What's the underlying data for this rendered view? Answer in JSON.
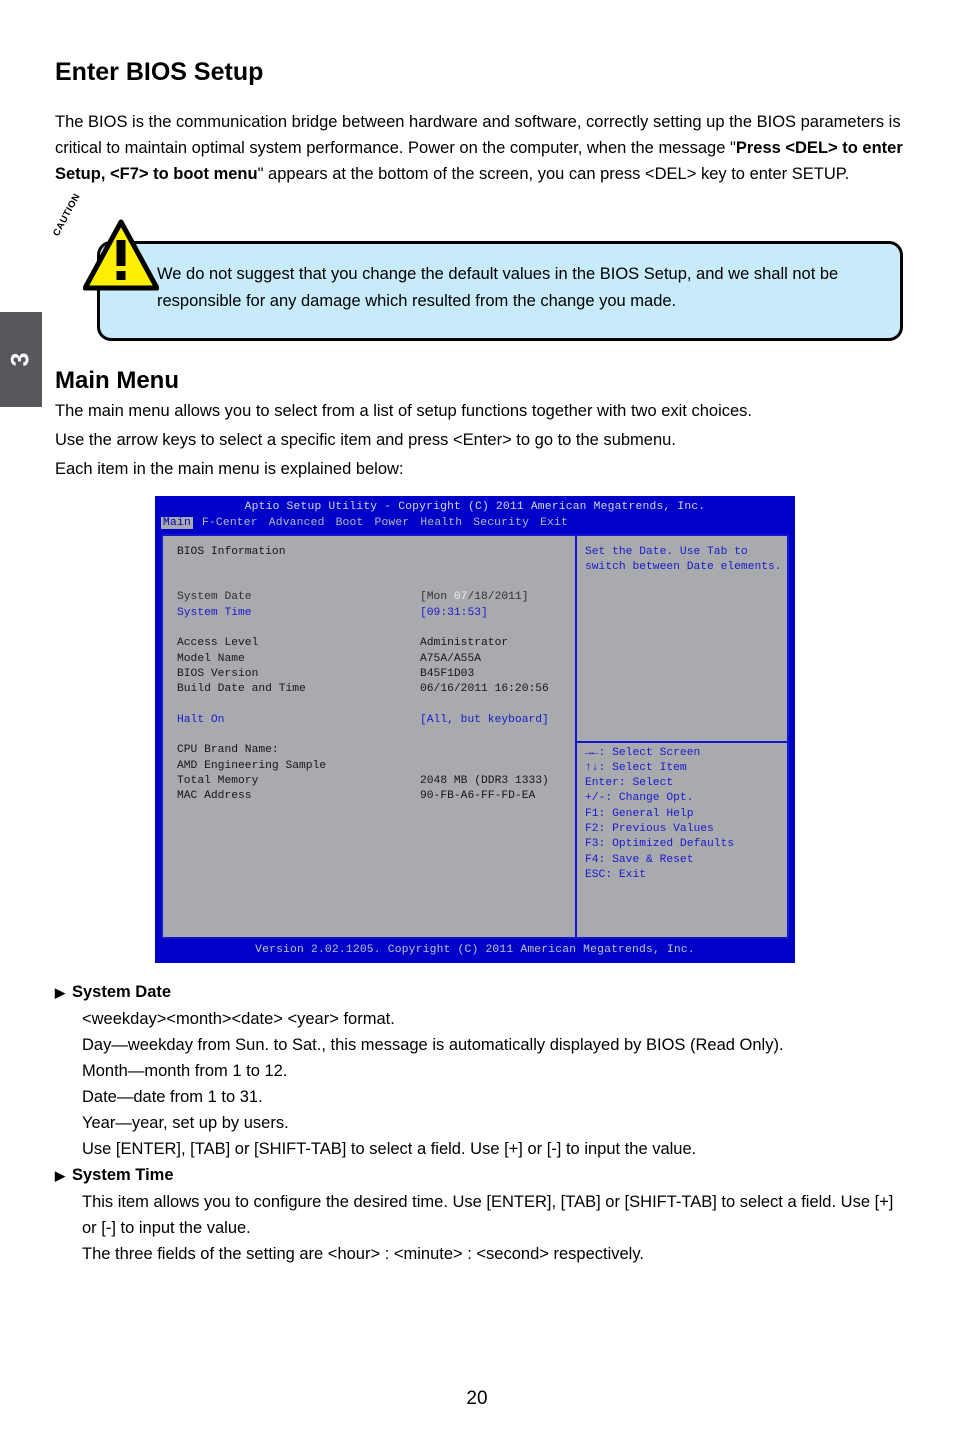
{
  "chapter_tab": {
    "number": "3"
  },
  "headings": {
    "enter_bios": "Enter BIOS Setup",
    "main_menu": "Main Menu"
  },
  "intro": {
    "part1": "The BIOS is the communication bridge between hardware and software, correctly setting up the BIOS parameters is critical to maintain optimal system performance. Power on the computer, when the message \"",
    "bold": "Press <DEL> to enter Setup, <F7> to boot menu",
    "part2": "\" appears at the bottom of the screen, you can press <DEL> key to enter SETUP."
  },
  "caution": {
    "label": "CAUTION",
    "mark": "!",
    "text": "We do not suggest that you change the default values in the BIOS Setup, and we shall not be responsible for any damage which resulted from the change you made."
  },
  "main_menu_desc": {
    "line1": "The main menu allows you to select from a list of setup functions together with two exit choices.",
    "line2": "Use the arrow keys to select a specific item and press <Enter> to go to the submenu.",
    "line3": "Each item in the main menu is explained below:"
  },
  "bios": {
    "titlebar": "Aptio Setup Utility - Copyright (C) 2011 American Megatrends, Inc.",
    "tabs": [
      {
        "label": "Main",
        "active": true
      },
      {
        "label": "F-Center",
        "active": false
      },
      {
        "label": "Advanced",
        "active": false
      },
      {
        "label": "Boot",
        "active": false
      },
      {
        "label": "Power",
        "active": false
      },
      {
        "label": "Health",
        "active": false
      },
      {
        "label": "Security",
        "active": false
      },
      {
        "label": "Exit",
        "active": false
      }
    ],
    "section_title": "BIOS Information",
    "rows": {
      "system_date_label": "System Date",
      "system_date_pre": "[Mon ",
      "system_date_hl": "07",
      "system_date_post": "/18/2011]",
      "system_time_label": "System Time",
      "system_time_value": "[09:31:53]",
      "access_level_label": "Access Level",
      "access_level_value": "Administrator",
      "model_name_label": "Model Name",
      "model_name_value": "A75A/A55A",
      "bios_version_label": "BIOS Version",
      "bios_version_value": "B45F1D03",
      "build_date_label": "Build Date and Time",
      "build_date_value": "06/16/2011 16:20:56",
      "halt_on_label": "Halt On",
      "halt_on_value": "[All, but keyboard]",
      "cpu_brand_label": "CPU Brand Name:",
      "cpu_brand_value": "AMD Engineering Sample",
      "total_memory_label": "Total Memory",
      "total_memory_value": "2048 MB (DDR3 1333)",
      "mac_address_label": "MAC Address",
      "mac_address_value": "90-FB-A6-FF-FD-EA"
    },
    "help_text": "Set the Date. Use Tab to\nswitch between Date elements.",
    "keys": "→←: Select Screen\n↑↓: Select Item\nEnter: Select\n+/-: Change Opt.\nF1: General Help\nF2: Previous Values\nF3: Optimized Defaults\nF4: Save & Reset\nESC: Exit",
    "footer": "Version 2.02.1205. Copyright (C) 2011 American Megatrends, Inc."
  },
  "bullets": [
    {
      "title": "System Date",
      "lines": [
        "<weekday><month><date> <year> format.",
        "Day—weekday from Sun. to Sat., this message is automatically displayed by BIOS (Read Only).",
        "Month—month from 1 to 12.",
        "Date—date from 1 to 31.",
        "Year—year, set up by users.",
        "Use [ENTER], [TAB] or [SHIFT-TAB] to select a field. Use [+] or [-] to input the value."
      ]
    },
    {
      "title": "System Time",
      "lines": [
        "This item allows you to configure the desired time. Use [ENTER], [TAB] or [SHIFT-TAB] to select a field. Use [+] or [-] to input the value.",
        "The three fields of the setting are <hour> : <minute> : <second> respectively."
      ]
    }
  ],
  "page_number": "20",
  "colors": {
    "bios_blue": "#0000c8",
    "bios_panel_gray": "#a8aaae",
    "bios_text_blue": "#1a1acd",
    "caution_fill": "#c8ebfa",
    "caution_triangle": "#ffef00",
    "chapter_tab": "#56585e"
  }
}
